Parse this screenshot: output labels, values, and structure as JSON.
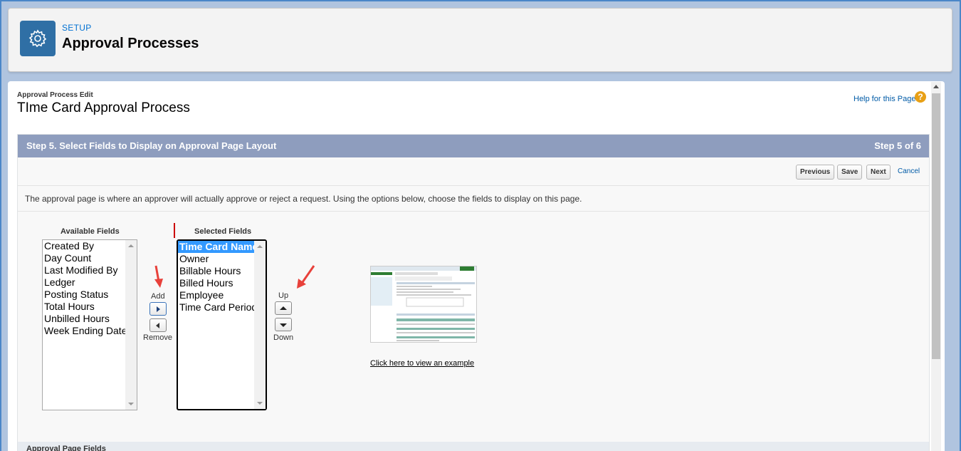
{
  "header": {
    "setup_label": "SETUP",
    "title": "Approval Processes",
    "icon": "gear-icon"
  },
  "page": {
    "subtitle": "Approval Process Edit",
    "title": "TIme Card Approval Process",
    "help_link": "Help for this Page"
  },
  "step": {
    "title": "Step 5. Select Fields to Display on Approval Page Layout",
    "count": "Step 5 of 6"
  },
  "buttons": {
    "previous": "Previous",
    "save": "Save",
    "next": "Next",
    "cancel": "Cancel"
  },
  "description": "The approval page is where an approver will actually approve or reject a request. Using the options below, choose the fields to display on this page.",
  "available": {
    "label": "Available Fields",
    "items": [
      "Created By",
      "Day Count",
      "Last Modified By",
      "Ledger",
      "Posting Status",
      "Total Hours",
      "Unbilled Hours",
      "Week Ending Date"
    ]
  },
  "selected": {
    "label": "Selected Fields",
    "items": [
      "Time Card Name",
      "Owner",
      "Billable Hours",
      "Billed Hours",
      "Employee",
      "Time Card Period"
    ],
    "selected_item": "Time Card Name"
  },
  "controls": {
    "add": "Add",
    "remove": "Remove",
    "up": "Up",
    "down": "Down"
  },
  "example_link": "Click here to view an example",
  "bottom_section": "Approval Page Fields",
  "colors": {
    "step_bar": "#8e9dbe",
    "header_icon": "#2f6fa5",
    "annotation_arrow": "#e8413b"
  }
}
